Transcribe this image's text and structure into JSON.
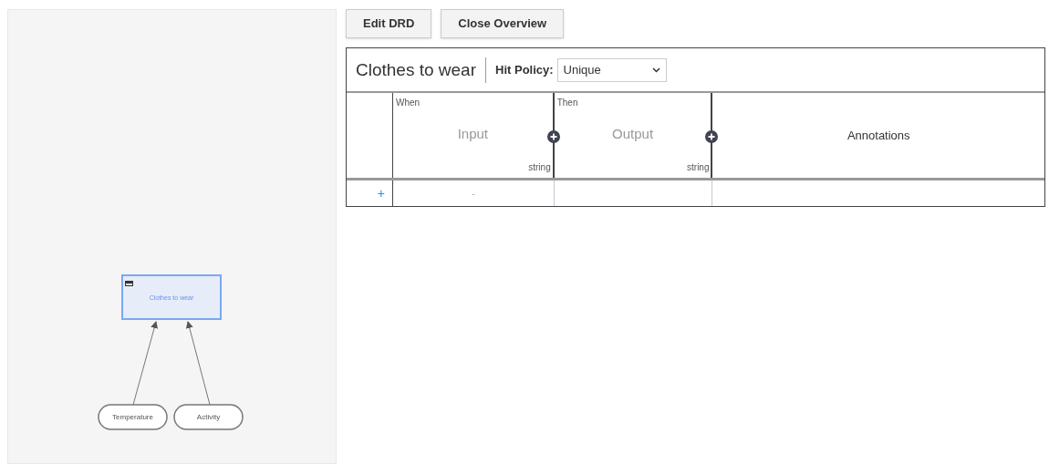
{
  "drd": {
    "decision": {
      "name": "Clothes to wear"
    },
    "inputs": [
      {
        "name": "Temperature"
      },
      {
        "name": "Activity"
      }
    ]
  },
  "buttons": [
    "Edit DRD",
    "Close Overview"
  ],
  "decision_table": {
    "name": "Clothes to wear",
    "hit_policy_label": "Hit Policy:",
    "hit_policy": "Unique",
    "columns": [
      {
        "kind": "input",
        "clause": "When",
        "label": "Input",
        "type": "string"
      },
      {
        "kind": "output",
        "clause": "Then",
        "label": "Output",
        "type": "string"
      },
      {
        "kind": "annotation",
        "label": "Annotations"
      }
    ],
    "rows": [
      {
        "add": "+",
        "cells": [
          "-",
          "",
          ""
        ]
      }
    ]
  }
}
